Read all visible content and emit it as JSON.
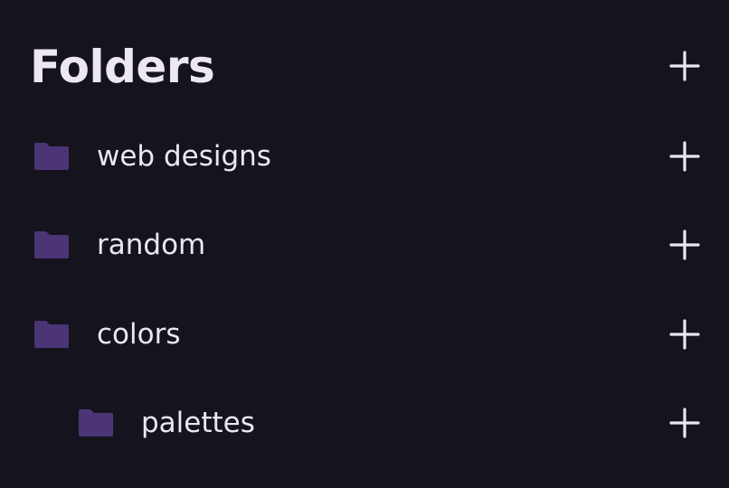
{
  "panel": {
    "title": "Folders",
    "add_icon": "plus-icon"
  },
  "folders": [
    {
      "label": "web designs",
      "depth": 0,
      "icon": "folder-icon",
      "action_icon": "plus-icon"
    },
    {
      "label": "random",
      "depth": 0,
      "icon": "folder-icon",
      "action_icon": "plus-icon"
    },
    {
      "label": "colors",
      "depth": 0,
      "icon": "folder-icon",
      "action_icon": "plus-icon"
    },
    {
      "label": "palettes",
      "depth": 1,
      "icon": "folder-icon",
      "action_icon": "plus-icon"
    }
  ],
  "colors": {
    "background": "#15141e",
    "text": "#ebe6f2",
    "folder": "#4b3576"
  }
}
